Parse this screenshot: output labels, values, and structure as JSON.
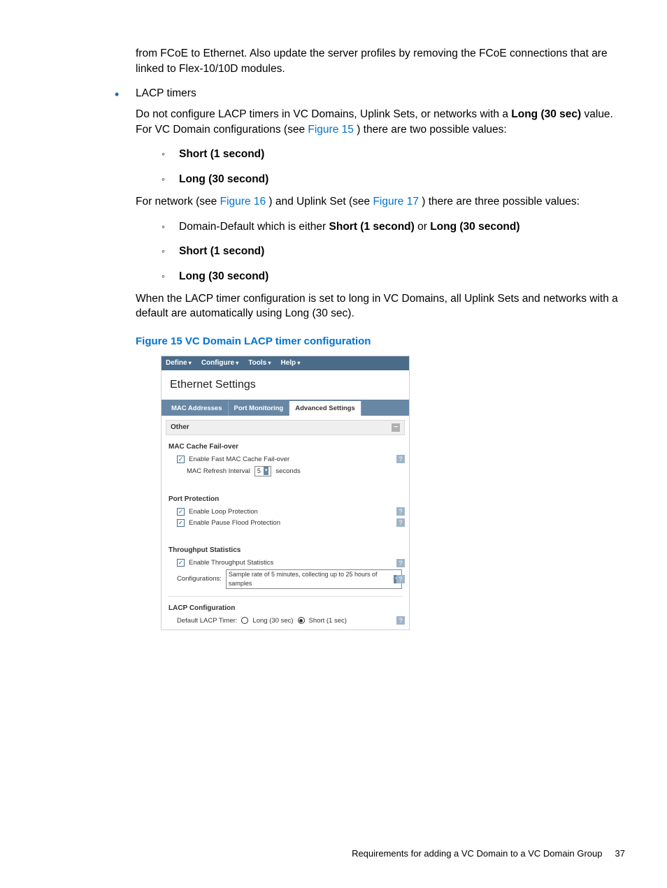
{
  "para0": "from FCoE to Ethernet. Also update the server profiles by removing the FCoE connections that are linked to Flex-10/10D modules.",
  "bullet1_head": "LACP timers",
  "bullet1_p1a": "Do not configure LACP timers in VC Domains, Uplink Sets, or networks with a ",
  "bullet1_p1b": "Long (30 sec)",
  "bullet1_p1c": " value. For VC Domain configurations (see ",
  "bullet1_link1": "Figure 15",
  "bullet1_p1d": ") there are two possible values:",
  "sub1": "Short (1 second)",
  "sub2": "Long (30 second)",
  "para2a": "For network (see ",
  "para2_link1": "Figure 16",
  "para2b": ") and Uplink Set (see ",
  "para2_link2": "Figure 17",
  "para2c": ") there are three possible values:",
  "sub3a": "Domain-Default which is either ",
  "sub3b": "Short (1 second)",
  "sub3c": "  or ",
  "sub3d": "Long (30 second)",
  "sub4": "Short (1 second)",
  "sub5": "Long (30 second)",
  "para3": "When the LACP timer configuration is set to long in VC Domains, all Uplink Sets and networks with a default are automatically using Long (30 sec).",
  "fig15_caption": "Figure 15 VC Domain LACP timer configuration",
  "fig": {
    "menu": {
      "define": "Define",
      "configure": "Configure",
      "tools": "Tools",
      "help": "Help"
    },
    "title": "Ethernet Settings",
    "tabs": {
      "t1": "MAC Addresses",
      "t2": "Port Monitoring",
      "t3": "Advanced Settings"
    },
    "other": "Other",
    "g1_head": "MAC Cache Fail-over",
    "g1_cb": "Enable Fast MAC Cache Fail-over",
    "g1_lbl": "MAC Refresh Interval",
    "g1_val": "5",
    "g1_unit": "seconds",
    "g2_head": "Port Protection",
    "g2_cb1": "Enable Loop Protection",
    "g2_cb2": "Enable Pause Flood Protection",
    "g3_head": "Throughput Statistics",
    "g3_cb": "Enable Throughput Statistics",
    "g3_lbl": "Configurations:",
    "g3_val": "Sample rate of 5 minutes, collecting up to 25 hours of samples",
    "g4_head": "LACP Configuration",
    "g4_lbl": "Default LACP Timer:",
    "g4_opt1": "Long (30 sec)",
    "g4_opt2": "Short (1 sec)"
  },
  "footer_text": "Requirements for adding a VC Domain to a VC Domain Group",
  "footer_page": "37"
}
